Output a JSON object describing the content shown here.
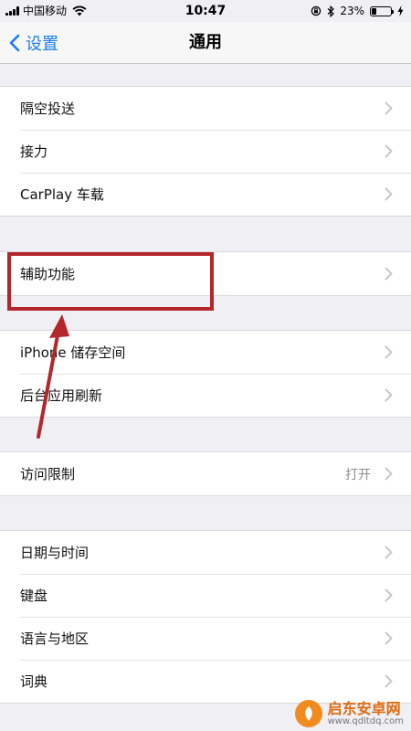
{
  "status_bar": {
    "carrier": "中国移动",
    "time": "10:47",
    "battery_text": "23%",
    "battery_level": 0.23
  },
  "nav": {
    "back_label": "设置",
    "title": "通用"
  },
  "groups": [
    {
      "rows": [
        {
          "label": "隔空投送"
        },
        {
          "label": "接力"
        },
        {
          "label": "CarPlay 车载"
        }
      ]
    },
    {
      "rows": [
        {
          "label": "辅助功能"
        }
      ]
    },
    {
      "rows": [
        {
          "label": "iPhone 储存空间"
        },
        {
          "label": "后台应用刷新"
        }
      ]
    },
    {
      "rows": [
        {
          "label": "访问限制",
          "value": "打开"
        }
      ]
    },
    {
      "rows": [
        {
          "label": "日期与时间"
        },
        {
          "label": "键盘"
        },
        {
          "label": "语言与地区"
        },
        {
          "label": "词典"
        }
      ]
    }
  ],
  "watermark": {
    "name": "启东安卓网",
    "url": "www.qdltdq.com"
  },
  "colors": {
    "accent": "#1a7cf5",
    "annotation": "#b3262a",
    "background": "#efeff4"
  }
}
